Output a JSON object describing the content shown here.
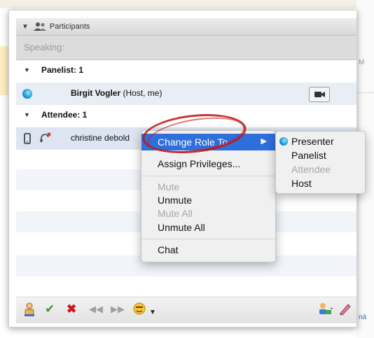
{
  "window": {
    "title": "Participants"
  },
  "background": {
    "partial_right_top": "M",
    "partial_right_bottom": "nä"
  },
  "speaking": {
    "label": "Speaking:"
  },
  "groups": {
    "panelist": {
      "label": "Panelist: 1"
    },
    "attendee": {
      "label": "Attendee: 1"
    }
  },
  "participants": [
    {
      "name": "Birgit Vogler",
      "suffix": "(Host, me)"
    },
    {
      "name": "christine debold"
    }
  ],
  "context_menu": {
    "items": [
      {
        "label": "Change Role To",
        "state": "highlighted",
        "submenu_arrow": "▶"
      },
      {
        "label": "Assign Privileges...",
        "state": "enabled"
      },
      {
        "label": "Mute",
        "state": "disabled"
      },
      {
        "label": "Unmute",
        "state": "enabled"
      },
      {
        "label": "Mute All",
        "state": "disabled"
      },
      {
        "label": "Unmute All",
        "state": "enabled"
      },
      {
        "label": "Chat",
        "state": "enabled"
      }
    ]
  },
  "role_submenu": {
    "items": [
      {
        "label": "Presenter",
        "state": "enabled"
      },
      {
        "label": "Panelist",
        "state": "enabled"
      },
      {
        "label": "Attendee",
        "state": "disabled"
      },
      {
        "label": "Host",
        "state": "enabled"
      }
    ]
  },
  "icons": {
    "header": "participants-icon",
    "toolbar": [
      "raise-hand-icon",
      "yes-check-icon",
      "no-x-icon",
      "rewind-icon",
      "fast-forward-icon",
      "emoticon-icon",
      "dropdown-arrow-icon",
      "user-settings-icon",
      "annotate-pen-icon"
    ]
  },
  "colors": {
    "accent": "#2f6fdb",
    "highlight_circle": "#be1414",
    "panelist_row": "#e9eef5",
    "attendee_row": "#dde5f0"
  }
}
